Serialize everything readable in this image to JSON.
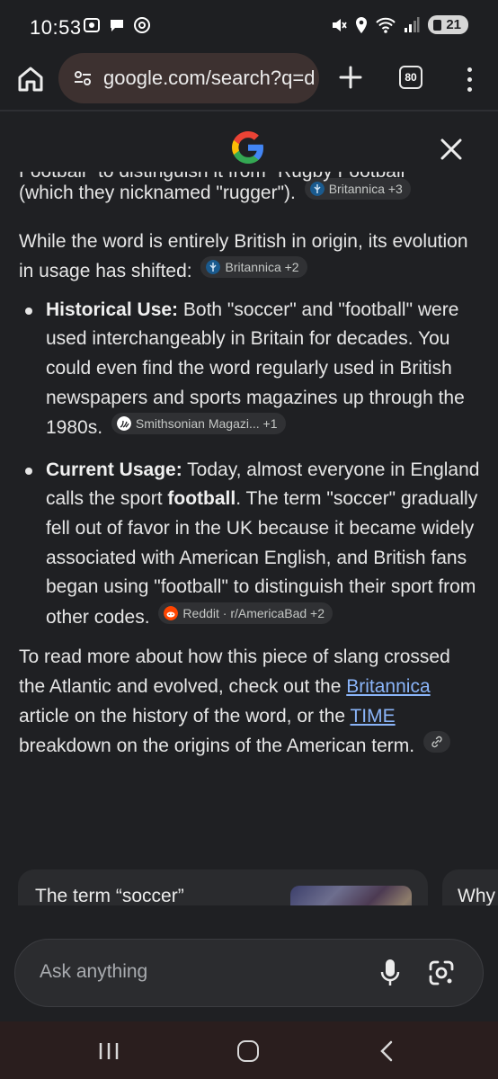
{
  "status_bar": {
    "time": "10:53",
    "battery": "21"
  },
  "browser": {
    "url": "google.com/search?q=d",
    "tab_count": "80"
  },
  "content": {
    "para1": {
      "text": "(which they nicknamed \"rugger\").",
      "cut_text": "Football\" to distinguish it from \"Rugby Football\"",
      "chip": "Britannica +3"
    },
    "para2": {
      "text": "While the word is entirely British in origin, its evolution in usage has shifted:",
      "chip": "Britannica +2"
    },
    "bullets": [
      {
        "label": "Historical Use:",
        "text": " Both \"soccer\" and \"football\" were used interchangeably in Britain for decades. You could even find the word regularly used in British newspapers and sports magazines up through the 1980s.",
        "chip": "Smithsonian Magazi... +1"
      },
      {
        "label": "Current Usage:",
        "text_before": " Today, almost everyone in England calls the sport ",
        "bold": "football",
        "text_after": ". The term \"soccer\" gradually fell out of favor in the UK because it became widely associated with American English, and British fans began using \"football\" to distinguish their sport from other codes.",
        "chip": "Reddit · r/AmericaBad +2"
      }
    ],
    "closing": {
      "t1": "To read more about how this piece of slang crossed the Atlantic and evolved, check out the ",
      "link1": "Britannica",
      "t2": " article on the history of the word, or the ",
      "link2": "TIME",
      "t3": " breakdown on the origins of the American term."
    }
  },
  "cards": [
    {
      "title": "The term “soccer”"
    },
    {
      "title": "Why"
    }
  ],
  "ask_bar": {
    "placeholder": "Ask anything"
  },
  "colors": {
    "link": "#8ab4f8",
    "background": "#1f2023",
    "url_pill": "#3d3130"
  }
}
